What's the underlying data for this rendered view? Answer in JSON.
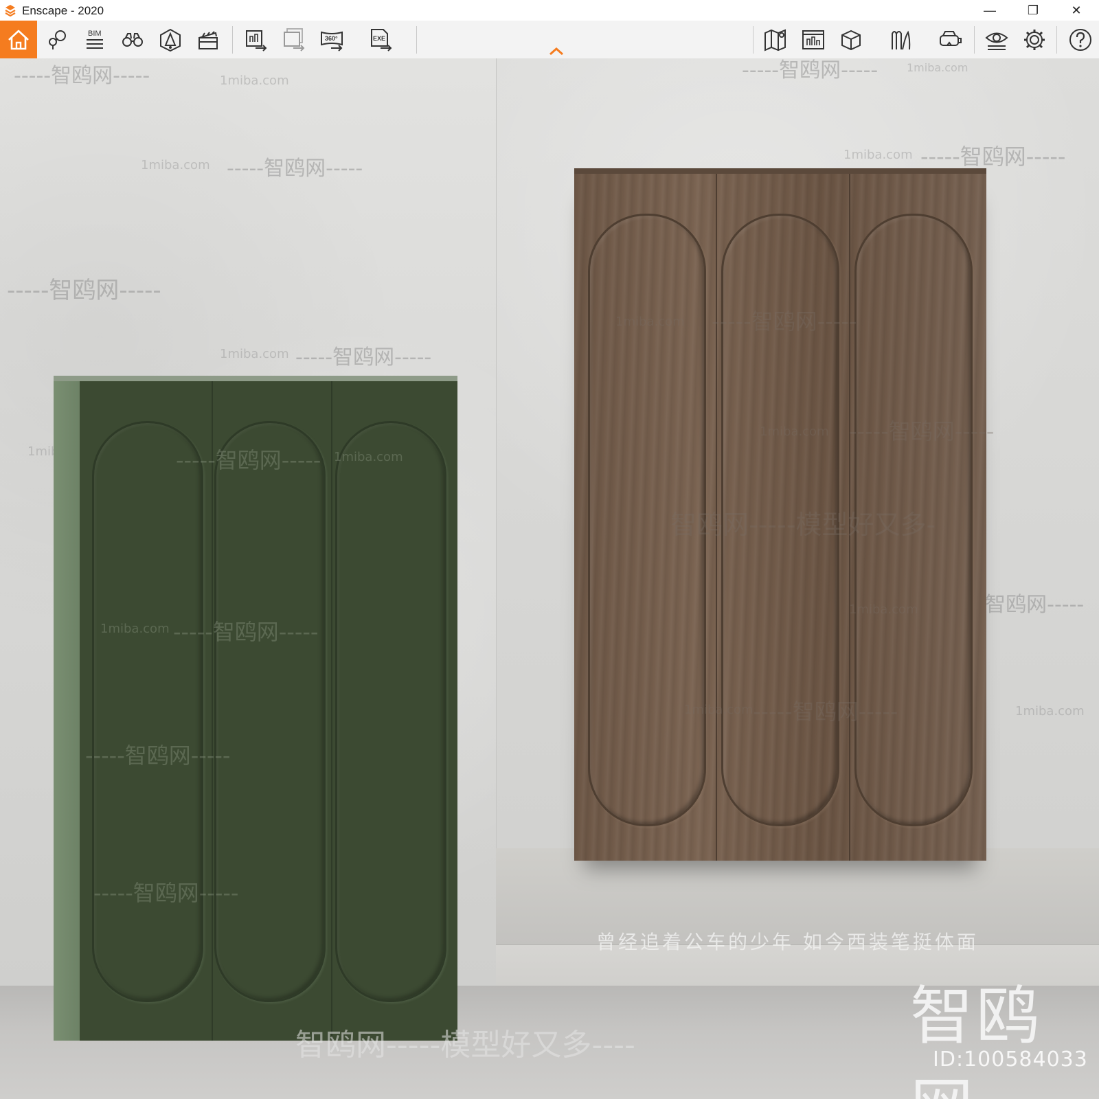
{
  "window": {
    "title": "Enscape - 2020",
    "controls": {
      "minimize": "—",
      "restore": "❐",
      "close": "✕"
    }
  },
  "toolbar": {
    "accent": "#f57c1f",
    "icons": [
      "home-icon",
      "tag-location-icon",
      "bim-icon",
      "binoculars-icon",
      "perspective-icon",
      "video-editor-icon",
      "export-screenshot-icon",
      "batch-render-icon",
      "panorama-360-icon",
      "export-exe-icon",
      "map-icon",
      "render-window-icon",
      "cube-icon",
      "asset-library-icon",
      "vr-headset-icon",
      "visual-settings-icon",
      "settings-gear-icon",
      "help-icon"
    ],
    "bim_label": "BIM",
    "pano_label": "360°",
    "exe_label": "EXE"
  },
  "viewport": {
    "caption": "曾经追着公车的少年 如今西装笔挺体面",
    "brand_mark": "智鸥网",
    "brand_id": "ID:100584033",
    "slogan": "智鸥网-----模型好又多----",
    "watermarks": {
      "site": "1miba.com",
      "cn_dashed": "-----智鸥网-----",
      "cn_slogan": "智鸥网-----模型好又多-"
    }
  }
}
